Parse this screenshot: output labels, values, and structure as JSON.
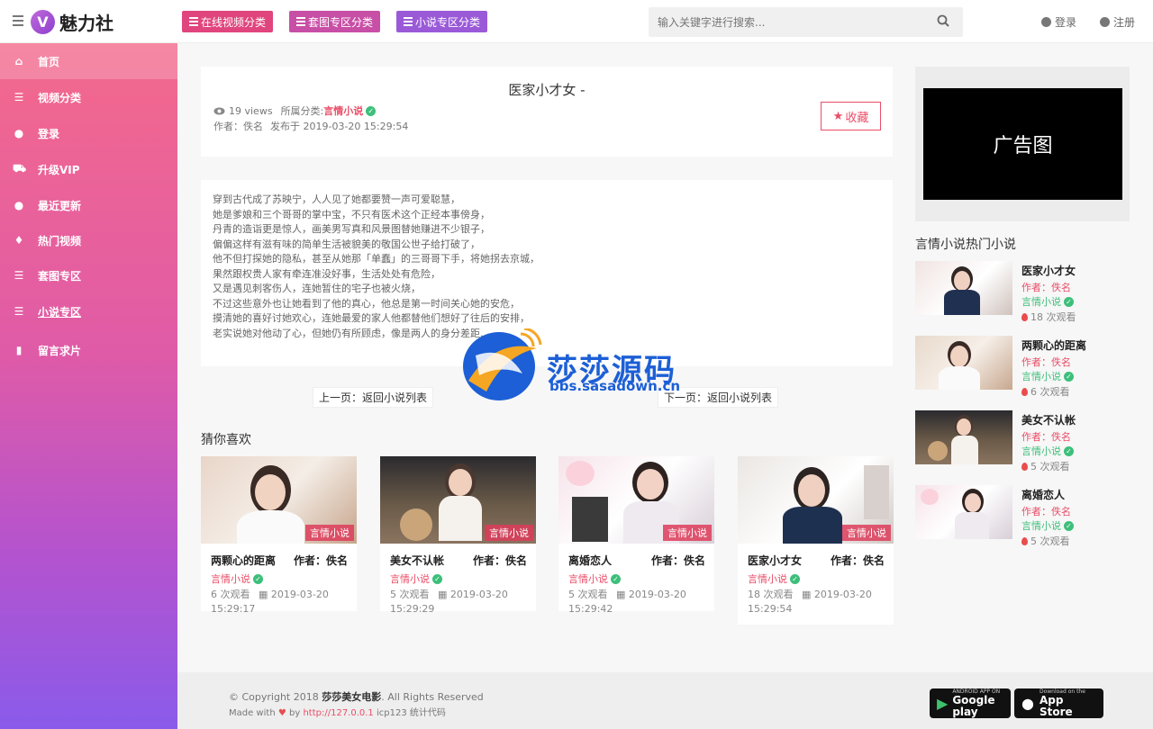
{
  "brand": {
    "logo_letter": "V",
    "name": "魅力社"
  },
  "header": {
    "categories": [
      "在线视频分类",
      "套图专区分类",
      "小说专区分类"
    ],
    "search_placeholder": "输入关键字进行搜索...",
    "login": "登录",
    "register": "注册"
  },
  "sidebar": {
    "items": [
      {
        "label": "首页",
        "icon": "home-icon"
      },
      {
        "label": "视频分类",
        "icon": "list-icon"
      },
      {
        "label": "登录",
        "icon": "user-circle-icon"
      },
      {
        "label": "升级VIP",
        "icon": "cart-icon"
      },
      {
        "label": "最近更新",
        "icon": "user-icon"
      },
      {
        "label": "热门视频",
        "icon": "fire-icon"
      },
      {
        "label": "套图专区",
        "icon": "list-icon"
      },
      {
        "label": "小说专区",
        "icon": "list-icon"
      },
      {
        "label": "留言求片",
        "icon": "clipboard-icon"
      }
    ]
  },
  "post": {
    "title": "医家小才女 -",
    "views": "19 views",
    "category_prefix": "所属分类:",
    "category": "言情小说",
    "author": "作者：佚名",
    "published": "发布于 2019-03-20 15:29:54",
    "favorite": "收藏",
    "content": [
      "穿到古代成了苏映宁，人人见了她都要赞一声可爱聪慧，",
      "她是爹娘和三个哥哥的掌中宝，不只有医术这个正经本事傍身，",
      "丹青的造诣更是惊人，画美男写真和风景图替她赚进不少银子，",
      "偏偏这样有滋有味的简单生活被貌美的敬国公世子给打破了，",
      "他不但打探她的隐私，甚至从她那「单蠢」的三哥哥下手，将她拐去京城，",
      "果然跟权贵人家有牵连准没好事，生活处处有危险，",
      "又是遇见刺客伤人，连她暂住的宅子也被火烧，",
      "不过这些意外也让她看到了他的真心，他总是第一时间关心她的安危，",
      "摸清她的喜好讨她欢心，连她最爱的家人他都替他们想好了往后的安排，",
      "老实说她对他动了心，但她仍有所顾虑，像是两人的身分差距……"
    ],
    "prev": "上一页：返回小说列表",
    "next": "下一页：返回小说列表"
  },
  "recommend": {
    "title": "猜你喜欢",
    "items": [
      {
        "title": "两颗心的距离",
        "author": "作者：佚名",
        "tag": "言情小说",
        "category": "言情小说",
        "views": "6 次观看",
        "date": "2019-03-20 15:29:17"
      },
      {
        "title": "美女不认帐",
        "author": "作者：佚名",
        "tag": "言情小说",
        "category": "言情小说",
        "views": "5 次观看",
        "date": "2019-03-20 15:29:29"
      },
      {
        "title": "离婚恋人",
        "author": "作者：佚名",
        "tag": "言情小说",
        "category": "言情小说",
        "views": "5 次观看",
        "date": "2019-03-20 15:29:42"
      },
      {
        "title": "医家小才女",
        "author": "作者：佚名",
        "tag": "言情小说",
        "category": "言情小说",
        "views": "18 次观看",
        "date": "2019-03-20 15:29:54"
      }
    ]
  },
  "ad": {
    "label": "广告图"
  },
  "hot": {
    "title": "言情小说热门小说",
    "items": [
      {
        "title": "医家小才女",
        "author": "作者：佚名",
        "category": "言情小说",
        "views": "18 次观看"
      },
      {
        "title": "两颗心的距离",
        "author": "作者：佚名",
        "category": "言情小说",
        "views": "6 次观看"
      },
      {
        "title": "美女不认帐",
        "author": "作者：佚名",
        "category": "言情小说",
        "views": "5 次观看"
      },
      {
        "title": "离婚恋人",
        "author": "作者：佚名",
        "category": "言情小说",
        "views": "5 次观看"
      }
    ]
  },
  "footer": {
    "copyright_prefix": "© Copyright 2018",
    "site_name": "莎莎美女电影",
    "rights": ". All Rights Reserved",
    "made_with": "Made with",
    "by": "by",
    "link": "http://127.0.0.1",
    "icp": "icp123 统计代码",
    "google_small": "ANDROID APP ON",
    "google_big": "Google play",
    "apple_small": "Download on the",
    "apple_big": "App Store"
  },
  "watermark": {
    "text": "莎莎源码",
    "url": "bbs.sasadown.cn"
  },
  "colors": {
    "accent": "#e94d67",
    "green": "#3dbf7a",
    "cat1": "#e0457d",
    "cat2": "#c84fa6",
    "cat3": "#9a5ad8"
  }
}
